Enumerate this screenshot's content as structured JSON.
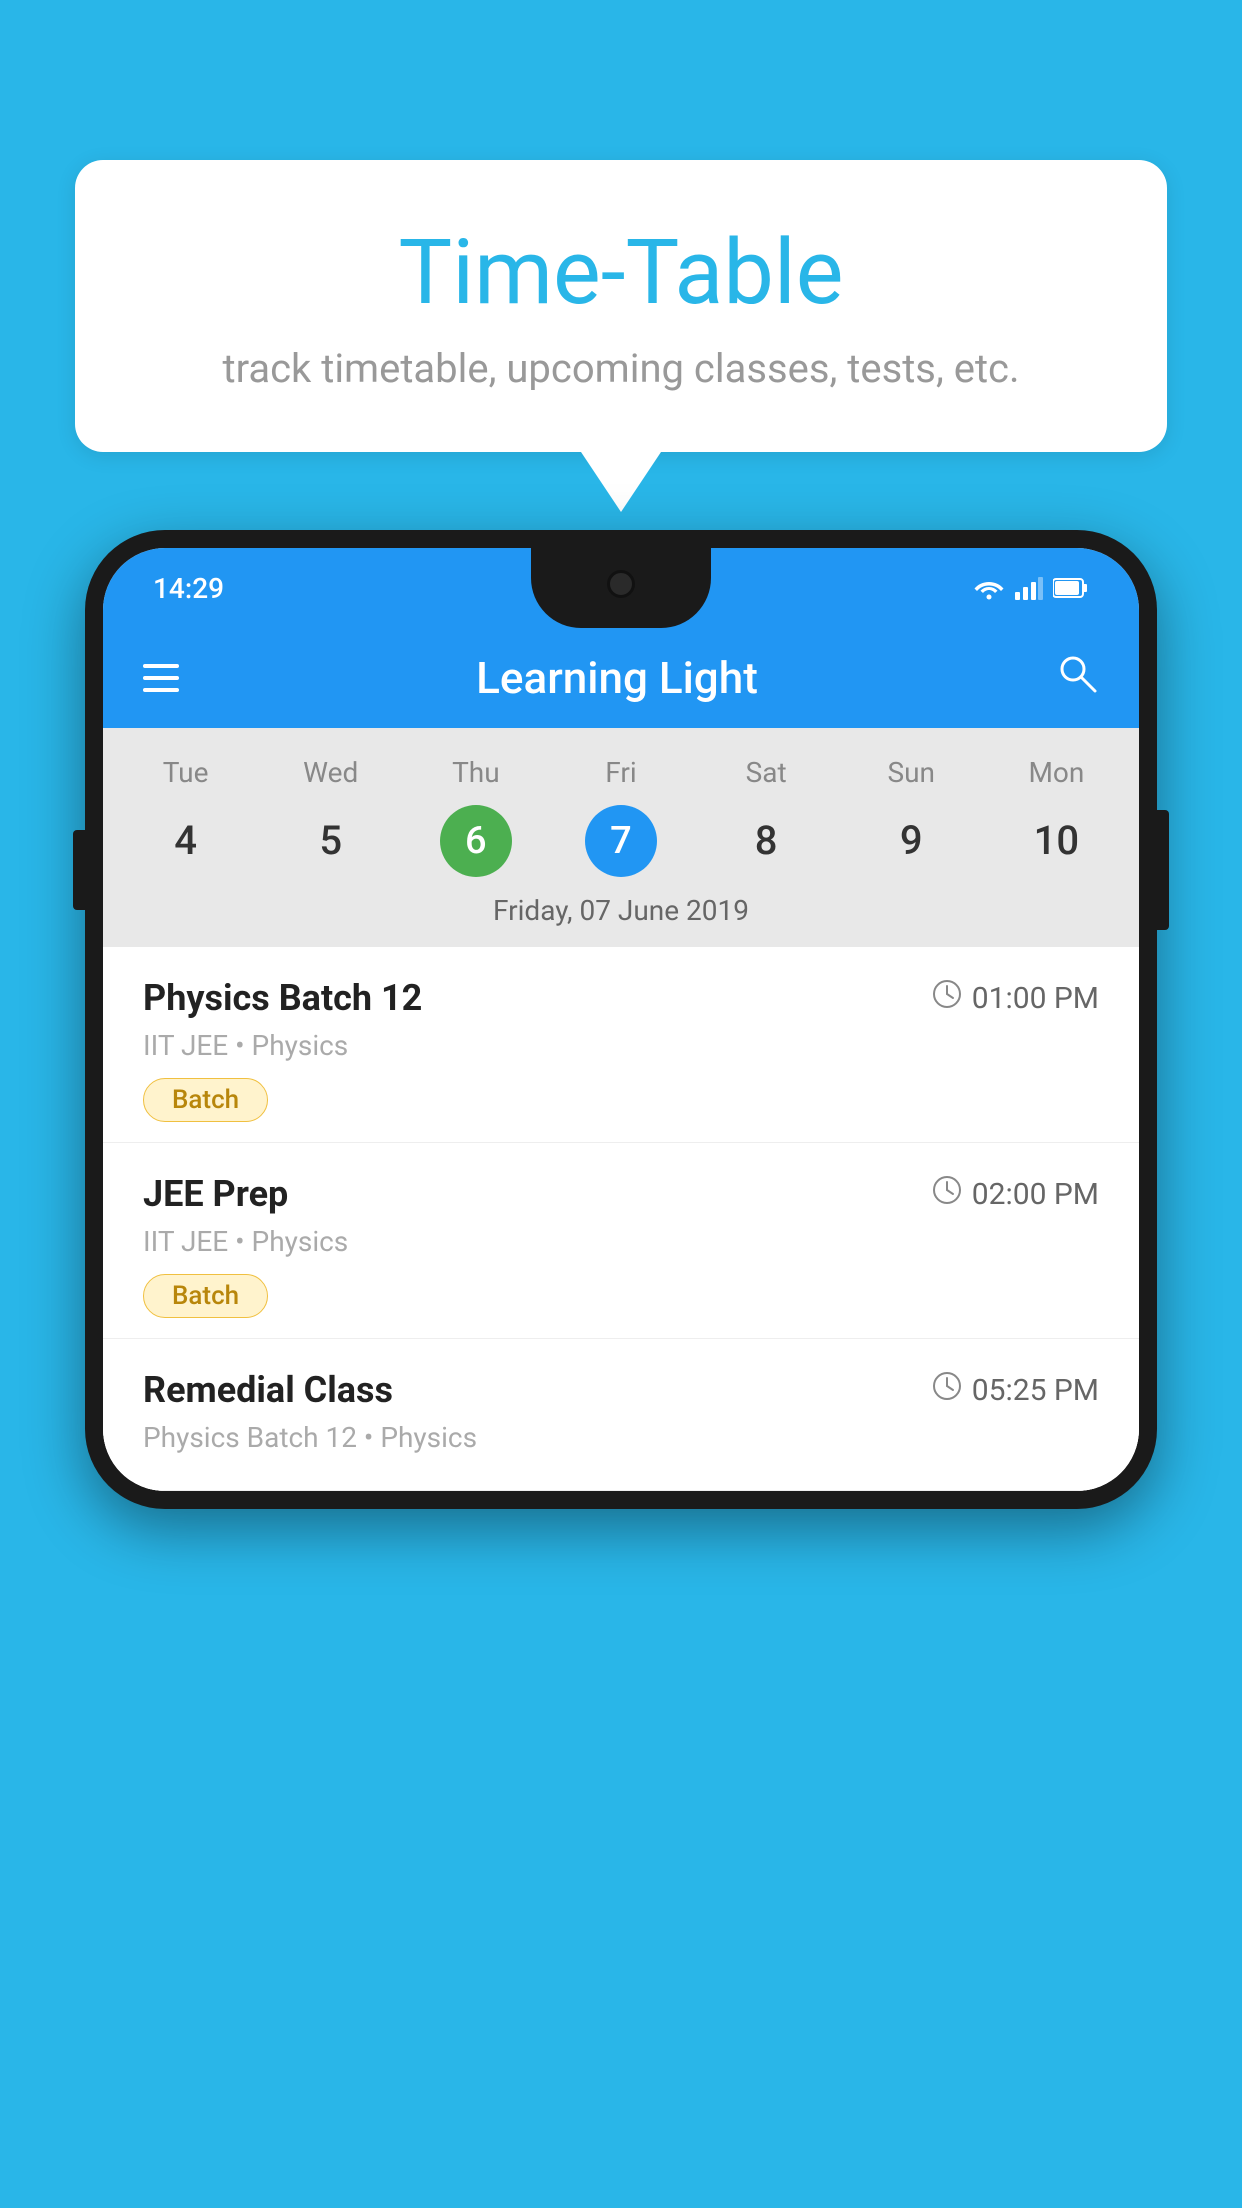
{
  "background_color": "#29B6E8",
  "speech_bubble": {
    "title": "Time-Table",
    "subtitle": "track timetable, upcoming classes, tests, etc."
  },
  "phone": {
    "status_bar": {
      "time": "14:29"
    },
    "app_header": {
      "title": "Learning Light"
    },
    "calendar": {
      "days": [
        "Tue",
        "Wed",
        "Thu",
        "Fri",
        "Sat",
        "Sun",
        "Mon"
      ],
      "numbers": [
        "4",
        "5",
        "6",
        "7",
        "8",
        "9",
        "10"
      ],
      "today_index": 2,
      "selected_index": 3,
      "date_label": "Friday, 07 June 2019"
    },
    "schedule_items": [
      {
        "title": "Physics Batch 12",
        "time": "01:00 PM",
        "meta": "IIT JEE • Physics",
        "badge": "Batch"
      },
      {
        "title": "JEE Prep",
        "time": "02:00 PM",
        "meta": "IIT JEE • Physics",
        "badge": "Batch"
      },
      {
        "title": "Remedial Class",
        "time": "05:25 PM",
        "meta": "Physics Batch 12 • Physics",
        "badge": ""
      }
    ]
  }
}
